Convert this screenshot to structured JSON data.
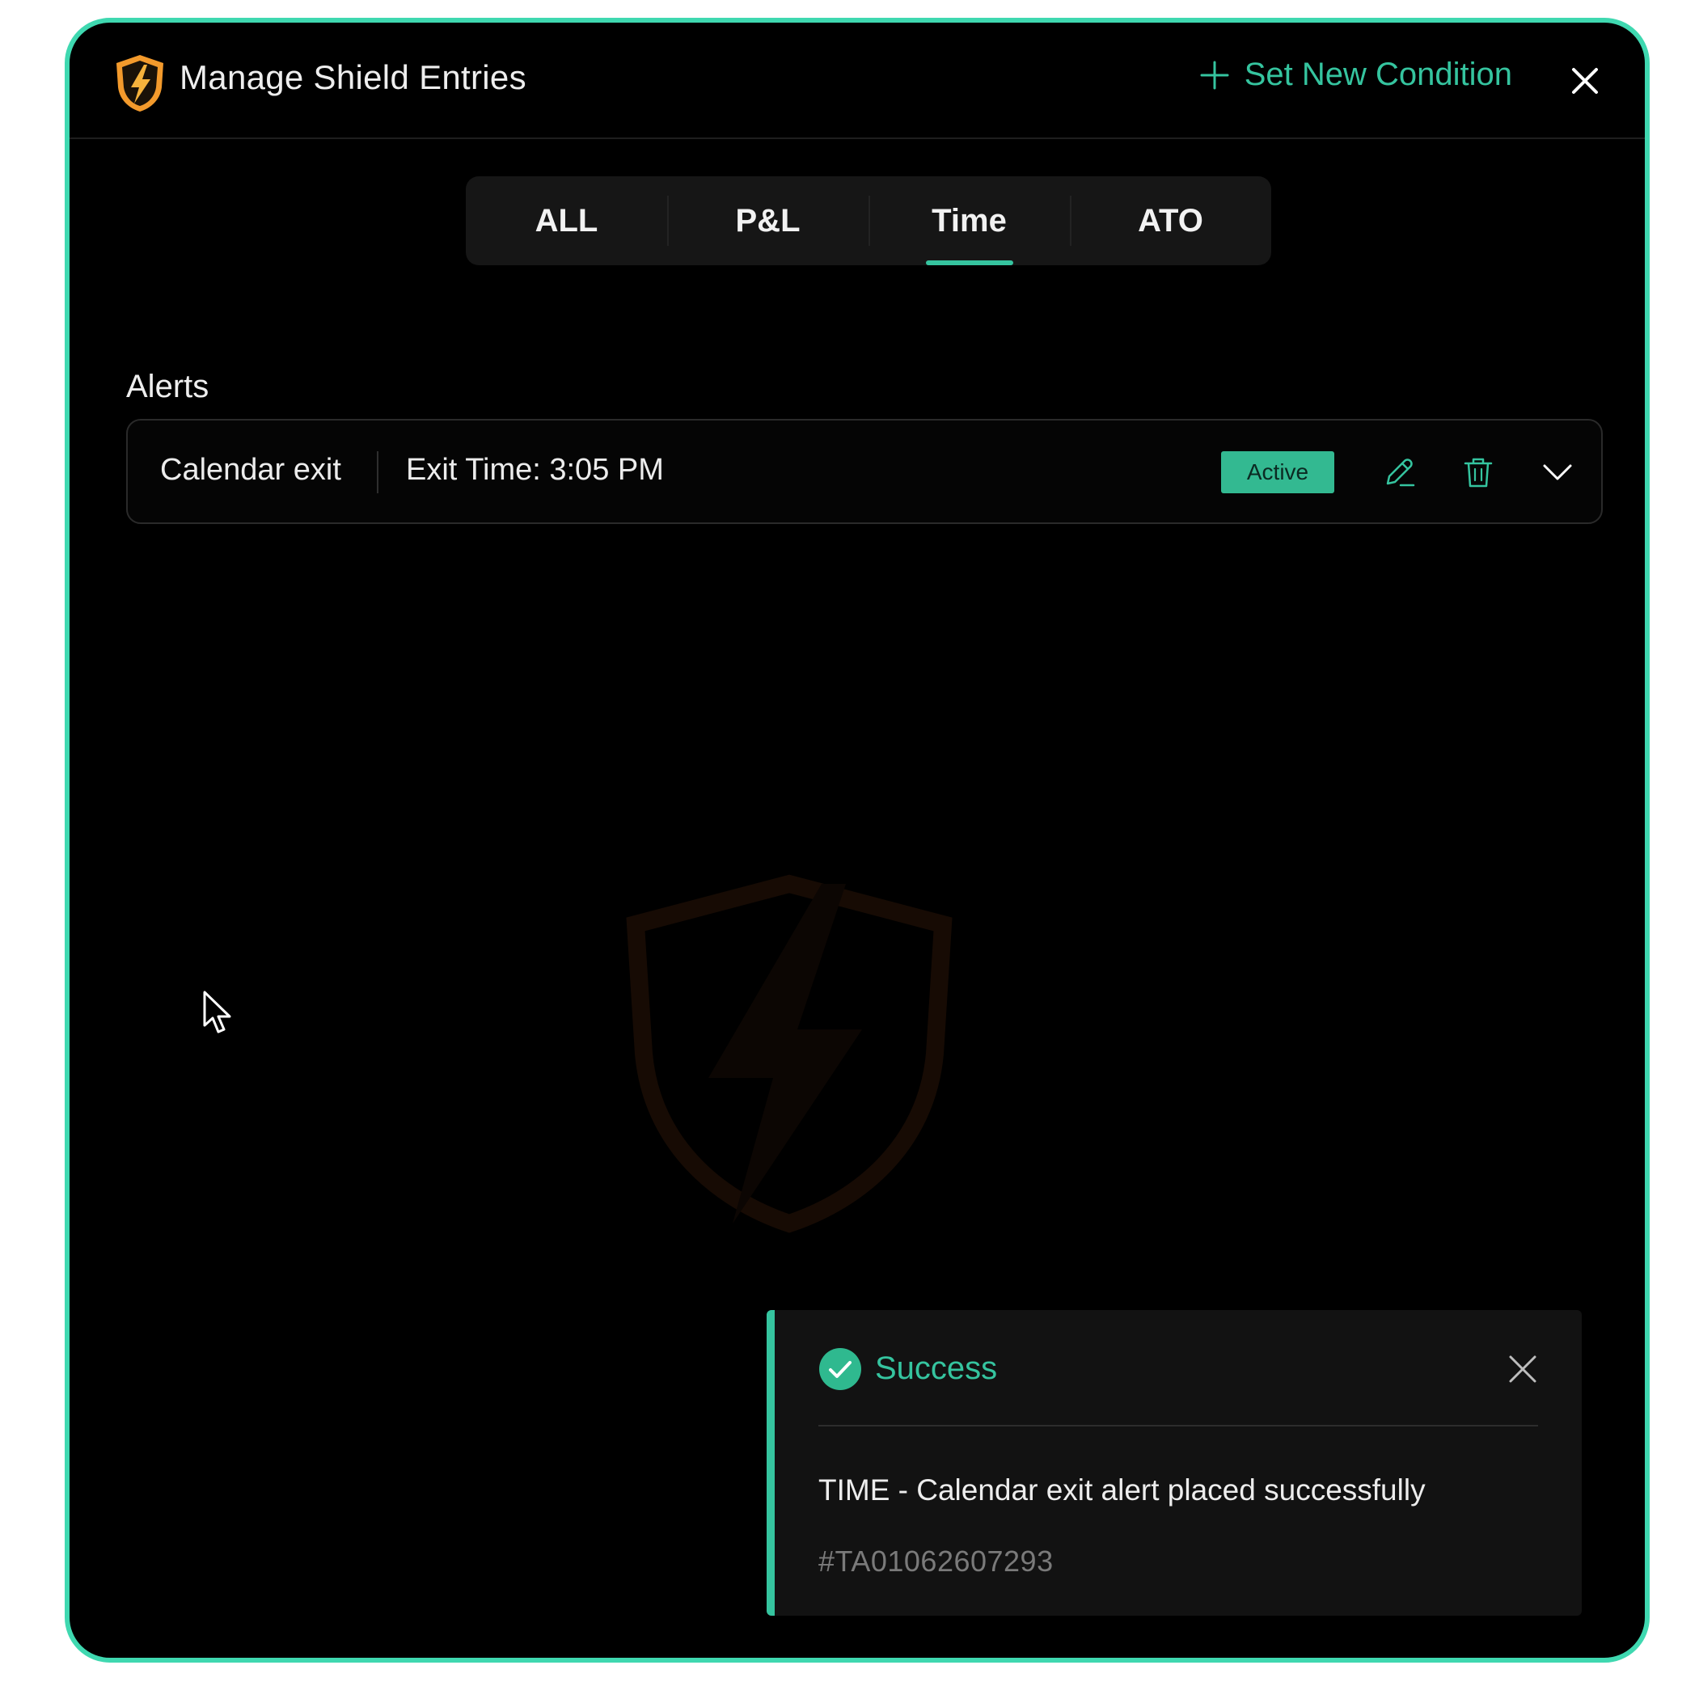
{
  "header": {
    "title": "Manage Shield Entries",
    "set_new_condition_label": "Set New Condition"
  },
  "tabs": [
    {
      "label": "ALL",
      "active": false
    },
    {
      "label": "P&L",
      "active": false
    },
    {
      "label": "Time",
      "active": true
    },
    {
      "label": "ATO",
      "active": false
    }
  ],
  "alerts": {
    "heading": "Alerts",
    "items": [
      {
        "name": "Calendar exit",
        "detail": "Exit Time: 3:05 PM",
        "status": "Active"
      }
    ]
  },
  "toast": {
    "title": "Success",
    "message": "TIME - Calendar exit alert placed successfully",
    "reference": "#TA01062607293"
  },
  "colors": {
    "accent": "#35c49f",
    "border": "#3fd8b0",
    "background": "#000000",
    "logo_orange": "#f39a2c"
  },
  "icons": {
    "logo": "shield-lightning-icon",
    "add": "plus-icon",
    "close": "close-icon",
    "edit": "pencil-icon",
    "delete": "trash-icon",
    "expand": "chevron-down-icon",
    "success": "check-circle-icon"
  }
}
